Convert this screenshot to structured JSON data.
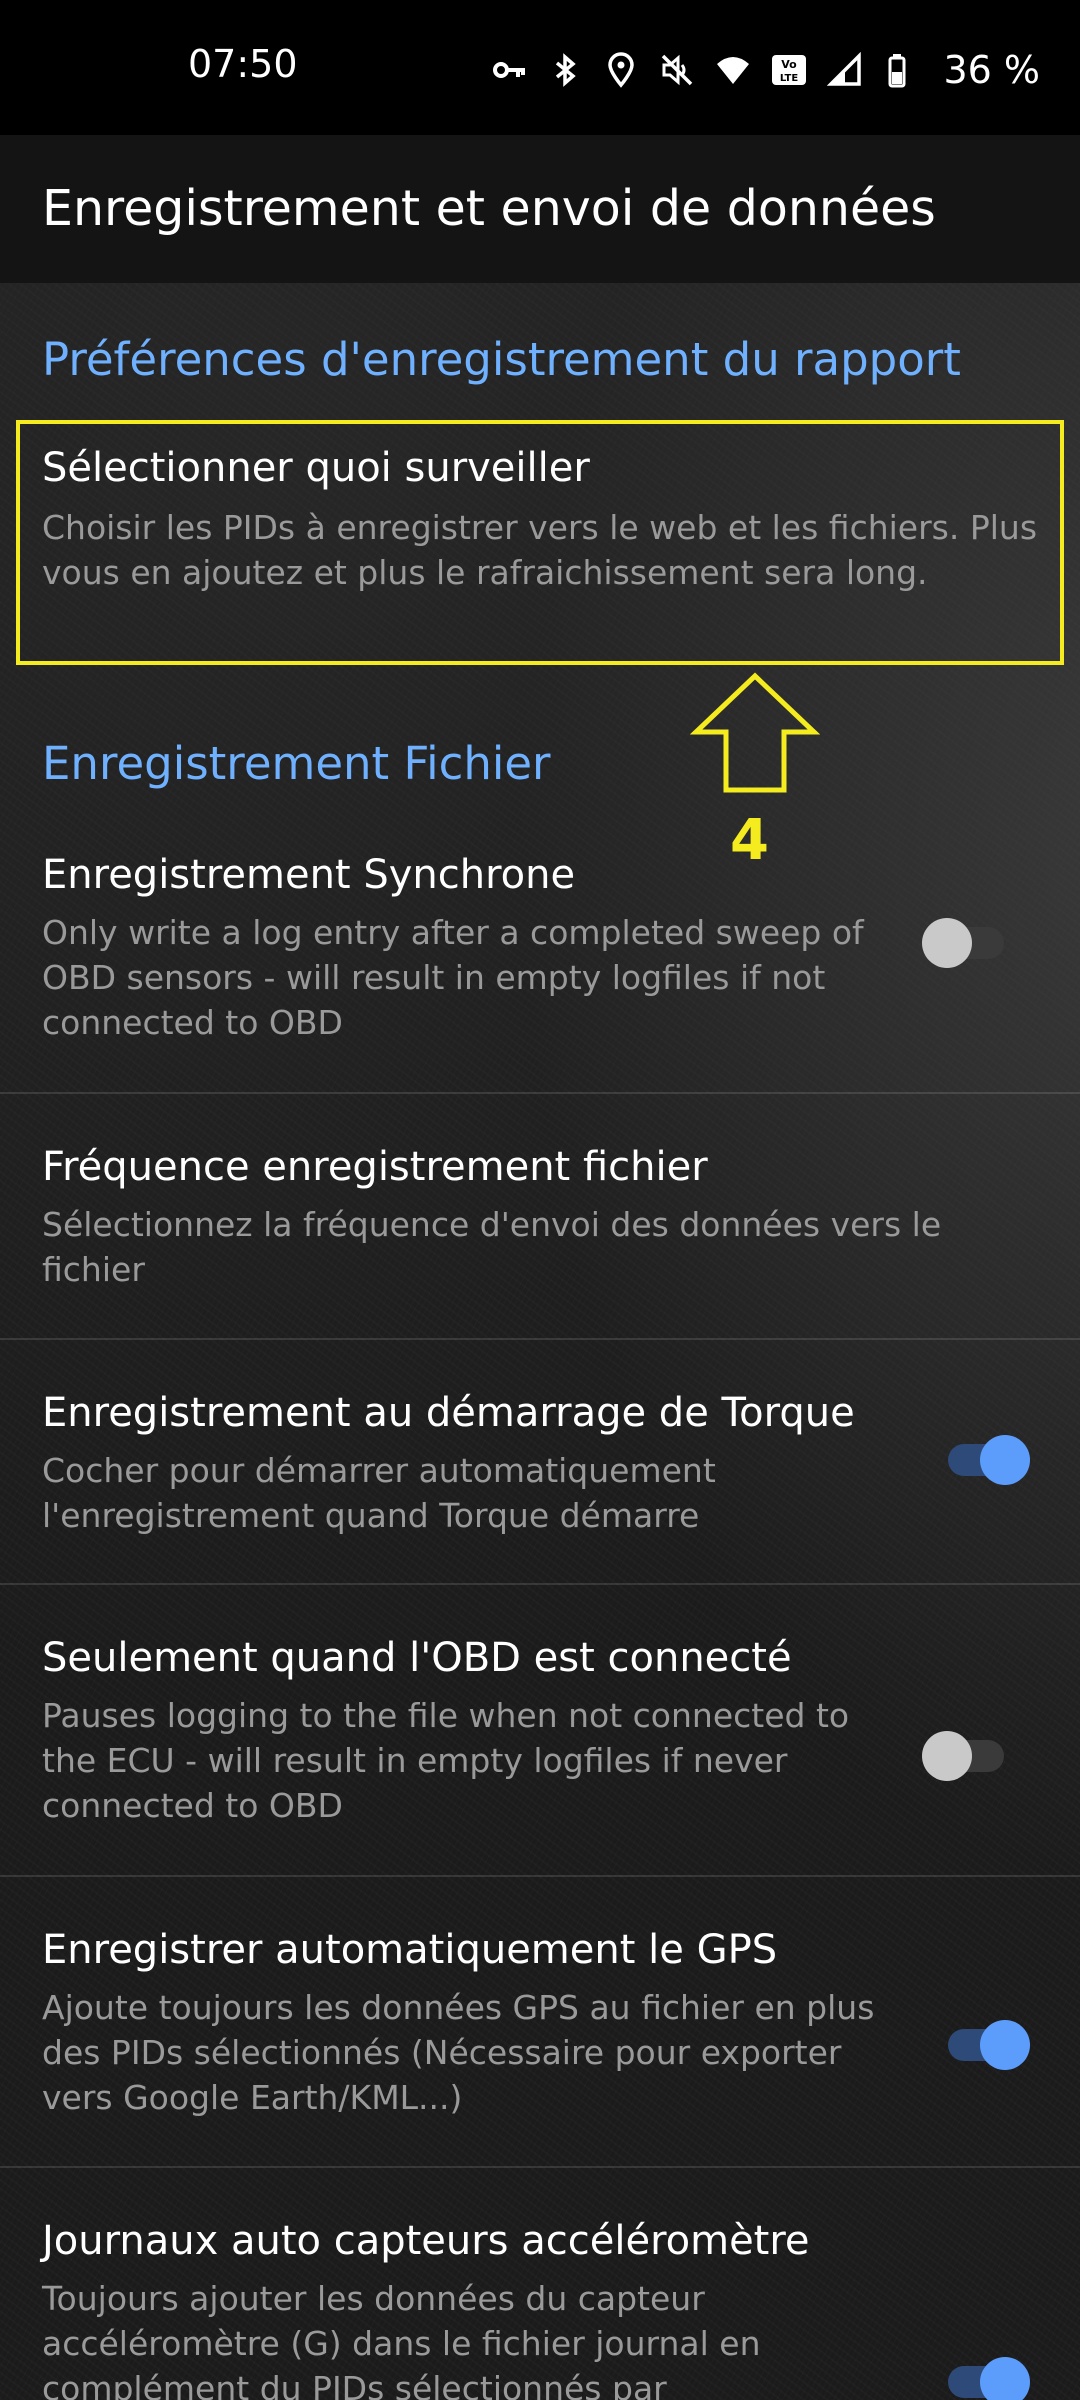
{
  "status_bar": {
    "time": "07:50",
    "battery_percent": "36 %",
    "icons": [
      "vpn-key-icon",
      "bluetooth-icon",
      "location-icon",
      "mute-icon",
      "wifi-icon",
      "volte-icon",
      "signal-icon",
      "battery-icon"
    ]
  },
  "app_bar": {
    "title": "Enregistrement et envoi de données"
  },
  "sections": {
    "report": {
      "title": "Préférences d'enregistrement du rapport"
    },
    "file": {
      "title": "Enregistrement Fichier"
    }
  },
  "prefs": {
    "select_monitor": {
      "title": "Sélectionner quoi surveiller",
      "summary": "Choisir les PIDs à enregistrer vers le web et les fichiers. Plus vous en ajoutez et plus le rafraichissement sera long."
    },
    "sync_logging": {
      "title": "Enregistrement Synchrone",
      "summary": "Only write a log entry after a completed sweep of OBD sensors - will result in empty logfiles if not connected to OBD",
      "enabled": false
    },
    "file_frequency": {
      "title": "Fréquence enregistrement fichier",
      "summary": "Sélectionnez la fréquence d'envoi des données vers le fichier"
    },
    "log_on_start": {
      "title": "Enregistrement au démarrage de Torque",
      "summary": "Cocher pour démarrer automatiquement l'enregistrement quand Torque démarre",
      "enabled": true
    },
    "only_obd_connected": {
      "title": "Seulement quand l'OBD est connecté",
      "summary": "Pauses logging to the file when not connected to the ECU - will result in empty logfiles if never connected to OBD",
      "enabled": false
    },
    "auto_gps": {
      "title": "Enregistrer automatiquement le GPS",
      "summary": "Ajoute toujours les données GPS au fichier en plus des PIDs sélectionnés (Nécessaire pour exporter vers Google Earth/KML...)",
      "enabled": true
    },
    "accel_logs": {
      "title": "Journaux auto capteurs accéléromètre",
      "summary": "Toujours ajouter les données du capteur accéléromètre (G) dans le fichier journal en complément du PIDs sélectionnés par",
      "enabled": true
    }
  },
  "annotation": {
    "number": "4",
    "color": "#f4ec1f"
  },
  "colors": {
    "accent": "#6fb1ff",
    "toggle_on": "#5c9dfb",
    "background": "#1b1b1b"
  }
}
